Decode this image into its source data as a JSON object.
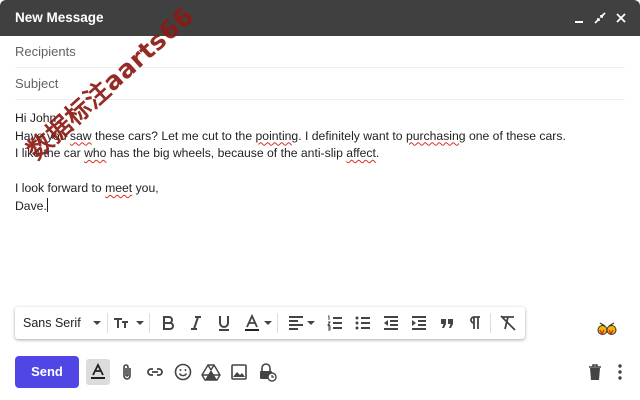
{
  "window": {
    "title": "New Message",
    "minimize_glyph": "▁",
    "close_glyph": "✕"
  },
  "fields": {
    "recipients_placeholder": "Recipients",
    "subject_placeholder": "Subject"
  },
  "body": {
    "line1": "Hi John,",
    "line2": {
      "p1": "Have you ",
      "w1": "saw",
      "p2": " these cars? Let me cut to the ",
      "w2": "pointing",
      "p3": ". I definitely want to ",
      "w3": "purchasing",
      "p4": " one of these cars."
    },
    "line3": {
      "p1": "I like the car ",
      "w1": "who",
      "p2": " has the big wheels, because of the anti-slip ",
      "w2": "affect",
      "p3": "."
    },
    "line5": {
      "p1": "I look forward to ",
      "w1": "meet",
      "p2": " you,"
    },
    "line6": "Dave."
  },
  "watermark": "数据标注aarts66",
  "formatting": {
    "font_family": "Sans Serif",
    "icons": [
      "text-size-icon",
      "bold-icon",
      "italic-icon",
      "underline-icon",
      "text-color-icon",
      "align-icon",
      "numbered-list-icon",
      "bulleted-list-icon",
      "indent-less-icon",
      "indent-more-icon",
      "quote-icon",
      "rtl-icon",
      "remove-formatting-icon"
    ]
  },
  "bottom": {
    "send_label": "Send",
    "icons": [
      "formatting-options-icon",
      "attach-icon",
      "link-icon",
      "emoji-icon",
      "drive-icon",
      "photo-icon",
      "confidential-mode-icon",
      "discard-icon",
      "more-options-icon"
    ]
  },
  "colors": {
    "title_bar": "#404040",
    "send_button": "#4f46e5",
    "spellcheck": "#d93025",
    "watermark": "#8b1a12"
  }
}
